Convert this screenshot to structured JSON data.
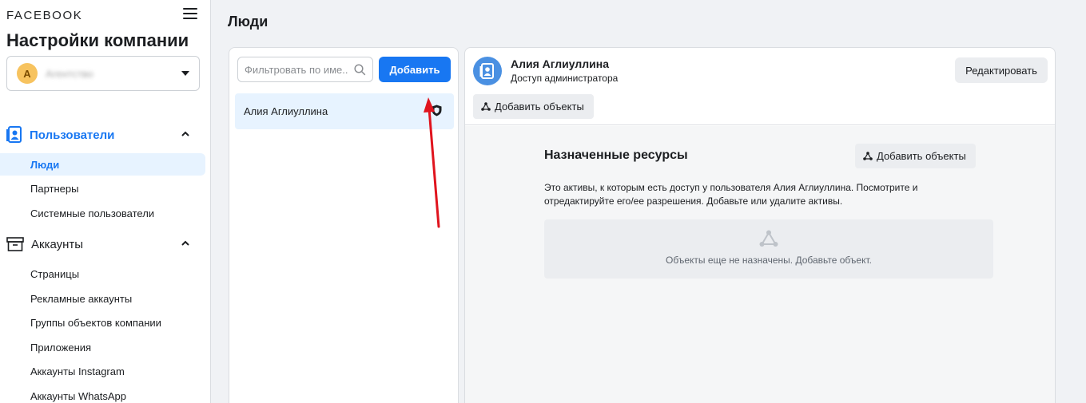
{
  "sidebar": {
    "brand": "FACEBOOK",
    "title": "Настройки компании",
    "account": {
      "avatar_letter": "A",
      "name": "Агентство"
    },
    "sections": {
      "users": {
        "label": "Пользователи",
        "items": [
          "Люди",
          "Партнеры",
          "Системные пользователи"
        ]
      },
      "accounts": {
        "label": "Аккаунты",
        "items": [
          "Страницы",
          "Рекламные аккаунты",
          "Группы объектов компании",
          "Приложения",
          "Аккаунты Instagram",
          "Аккаунты WhatsApp"
        ]
      }
    }
  },
  "main": {
    "title": "Люди",
    "list": {
      "filter_placeholder": "Фильтровать по име...",
      "add_button": "Добавить",
      "people": [
        {
          "name": "Алия Аглиуллина"
        }
      ]
    },
    "detail": {
      "user_name": "Алия Аглиуллина",
      "role": "Доступ администратора",
      "edit_button": "Редактировать",
      "add_objects_button": "Добавить объекты",
      "resources": {
        "title": "Назначенные ресурсы",
        "add_objects_button": "Добавить объекты",
        "description": "Это активы, к которым есть доступ у пользователя Алия Аглиуллина. Посмотрите и отредактируйте его/ее разрешения. Добавьте или удалите активы.",
        "empty_text": "Объекты еще не назначены. Добавьте объект."
      }
    }
  },
  "colors": {
    "accent": "#1877f2",
    "active_bg": "#e7f3ff",
    "annotation_arrow": "#e0141e"
  }
}
